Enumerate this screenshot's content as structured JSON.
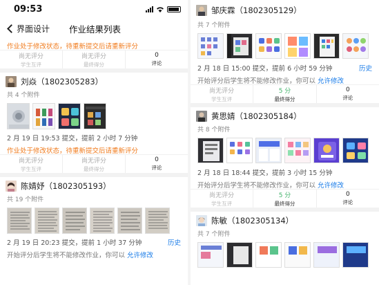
{
  "status": {
    "time": "09:53"
  },
  "nav": {
    "back_label": "界面设计",
    "title": "作业结果列表"
  },
  "left": {
    "top_warning": "作业处于修改状态，待重新提交后请重新评分",
    "top_stats": {
      "peer": "尚无评分",
      "peer_label": "学生互评",
      "final": "尚无评分",
      "final_label": "最终得分",
      "comments": "0",
      "comments_label": "评论"
    },
    "students": [
      {
        "name": "刘焱（1802305283）",
        "count": "共 4 个附件",
        "meta": "2 月 19 日 19:53 提交，提前 2 小时 7 分钟",
        "warning": "作业处于修改状态，待重新提交后请重新评分",
        "stats": {
          "peer": "尚无评分",
          "peer_label": "学生互评",
          "final": "尚无评分",
          "final_label": "最终得分",
          "comments": "0",
          "comments_label": "评论"
        }
      },
      {
        "name": "陈婧妤（1802305193）",
        "count": "共 19 个附件",
        "meta": "2 月 19 日 20:23 提交，提前 1 小时 37 分钟",
        "history": "历史",
        "note": "开始评分后学生将不能修改作业，你可以",
        "note_link": "允许修改"
      }
    ]
  },
  "right": {
    "students": [
      {
        "name": "邹庆霖（1802305129）",
        "count": "共 7 个附件",
        "meta": "2 月 18 日 15:00 提交，提前 6 小时 59 分钟",
        "history": "历史",
        "note": "开始评分后学生将不能修改作业，你可以",
        "note_link": "允许修改",
        "stats": {
          "peer": "尚无评分",
          "peer_label": "学生互评",
          "final": "5 分",
          "final_label": "最终得分",
          "comments": "0",
          "comments_label": "评论"
        }
      },
      {
        "name": "黄思婧（1802305184）",
        "count": "共 8 个附件",
        "meta": "2 月 18 日 18:44 提交，提前 3 小时 15 分钟",
        "note": "开始评分后学生将不能修改作业，你可以",
        "note_link": "允许修改",
        "stats": {
          "peer": "尚无评分",
          "peer_label": "学生互评",
          "final": "5 分",
          "final_label": "最终得分",
          "comments": "0",
          "comments_label": "评论"
        }
      },
      {
        "name": "陈敏（1802305134）",
        "count": "共 7 个附件"
      }
    ]
  },
  "colors": {
    "warning": "#f07c1f",
    "link": "#1a7ce8",
    "score": "#42b36b"
  }
}
